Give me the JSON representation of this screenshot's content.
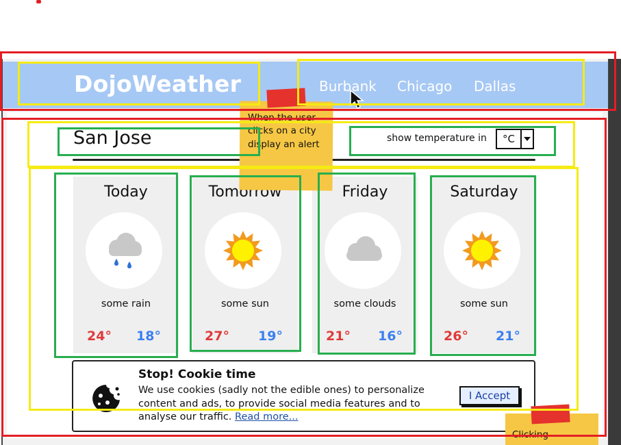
{
  "colors": {
    "header_bg": "#a6c8f4",
    "annot_red": "#e31e24",
    "annot_yellow": "#f5eb12",
    "annot_green": "#27ae4f",
    "temp_high": "#e03a3a",
    "temp_low": "#3a7ff0",
    "note": "#f6c744"
  },
  "header": {
    "brand": "DojoWeather",
    "nav": [
      {
        "label": "Burbank"
      },
      {
        "label": "Chicago"
      },
      {
        "label": "Dallas"
      }
    ]
  },
  "main": {
    "city": "San Jose",
    "unit_label": "show temperature in",
    "unit_value": "°C"
  },
  "forecast": [
    {
      "day": "Today",
      "icon": "rain-cloud-icon",
      "desc": "some rain",
      "high": "24°",
      "low": "18°"
    },
    {
      "day": "Tomorrow",
      "icon": "sun-icon",
      "desc": "some sun",
      "high": "27°",
      "low": "19°"
    },
    {
      "day": "Friday",
      "icon": "cloud-icon",
      "desc": "some clouds",
      "high": "21°",
      "low": "16°"
    },
    {
      "day": "Saturday",
      "icon": "sun-icon",
      "desc": "some sun",
      "high": "26°",
      "low": "21°"
    }
  ],
  "cookie": {
    "icon": "cookie-icon",
    "title": "Stop! Cookie time",
    "body": "We use cookies (sadly not the edible ones) to personalize content and ads, to provide social media features and to analyse our traffic.",
    "link": "Read more...",
    "accept": "I Accept"
  },
  "notes": {
    "note1": "When the user clicks on a city display an alert",
    "note2": "Clicking"
  }
}
